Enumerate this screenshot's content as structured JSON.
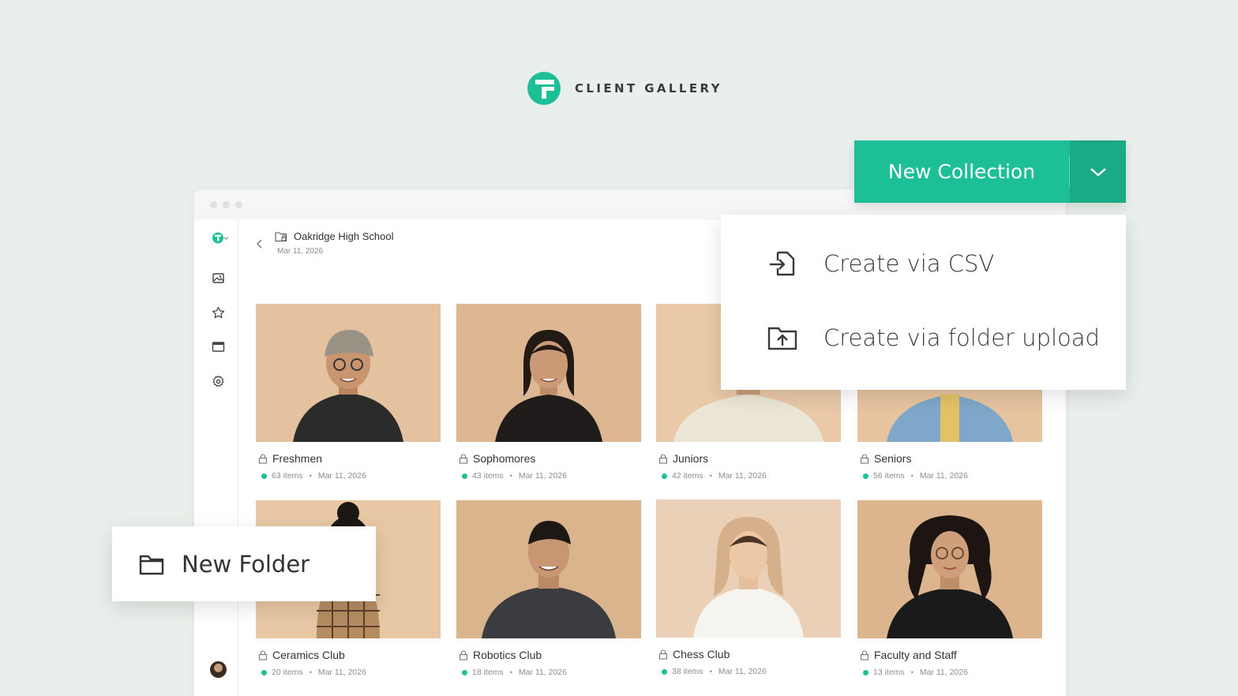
{
  "brand": {
    "name": "CLIENT GALLERY",
    "logo_icon": "client-gallery-logo",
    "color": "#1dbf96"
  },
  "sidebar": {
    "items": [
      {
        "icon": "gallery-icon"
      },
      {
        "icon": "star-icon"
      },
      {
        "icon": "browser-window-icon"
      },
      {
        "icon": "gear-icon"
      }
    ],
    "expand_icon": "double-chevron-right-icon"
  },
  "breadcrumb": {
    "title": "Oakridge High School",
    "date": "Mar 11, 2026"
  },
  "collections": [
    {
      "title": "Freshmen",
      "items": "63 items",
      "date": "Mar 11, 2026"
    },
    {
      "title": "Sophomores",
      "items": "43 items",
      "date": "Mar 11, 2026"
    },
    {
      "title": "Juniors",
      "items": "42 items",
      "date": "Mar 11, 2026"
    },
    {
      "title": "Seniors",
      "items": "56 items",
      "date": "Mar 11, 2026"
    },
    {
      "title": "Ceramics Club",
      "items": "20 items",
      "date": "Mar 11, 2026"
    },
    {
      "title": "Robotics Club",
      "items": "18 items",
      "date": "Mar 11, 2026"
    },
    {
      "title": "Chess Club",
      "items": "38 items",
      "date": "Mar 11, 2026"
    },
    {
      "title": "Faculty and Staff",
      "items": "13 items",
      "date": "Mar 11, 2026"
    }
  ],
  "new_collection": {
    "label": "New Collection",
    "menu": [
      {
        "label": "Create via CSV",
        "icon": "file-import-icon"
      },
      {
        "label": "Create via folder upload",
        "icon": "folder-upload-icon"
      }
    ]
  },
  "new_folder": {
    "label": "New Folder",
    "icon": "folder-icon"
  },
  "meta_separator": "•",
  "colors": {
    "accent": "#1dbf96",
    "accent_dark": "#1aaa86",
    "background": "#e9efea",
    "photo_bg": "#e4c29f"
  }
}
